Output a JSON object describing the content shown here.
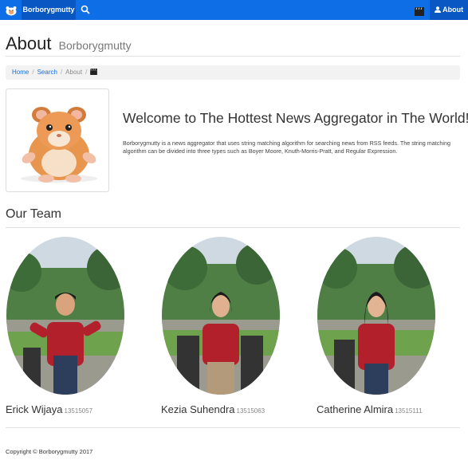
{
  "navbar": {
    "brand": "Borborygmutty",
    "about_label": "About",
    "logo_icon": "hamster-logo-icon",
    "search_icon": "search-icon",
    "film_icon": "film-icon",
    "user_icon": "user-icon",
    "bg_color": "#0e6ee6",
    "active_color": "#0857c2"
  },
  "header": {
    "title": "About",
    "subtitle": "Borborygmutty"
  },
  "breadcrumb": {
    "items": [
      "Home",
      "Search",
      "About"
    ],
    "trailing_icon": "film-icon"
  },
  "intro": {
    "welcome": "Welcome to The Hottest News Aggregator in The World!",
    "description": "Borborygmutty is a news aggregator that uses string matching algorithm for searching news from RSS feeds. The string matching algorithm can be divided into three types such as Boyer Moore, Knuth-Morris-Pratt, and Regular Expression."
  },
  "team": {
    "title": "Our Team",
    "members": [
      {
        "name": "Erick Wijaya",
        "id": "13515057"
      },
      {
        "name": "Kezia Suhendra",
        "id": "13515063"
      },
      {
        "name": "Catherine Almira",
        "id": "13515111"
      }
    ]
  },
  "footer": {
    "copyright": "Copyright © Borborygmutty 2017"
  }
}
